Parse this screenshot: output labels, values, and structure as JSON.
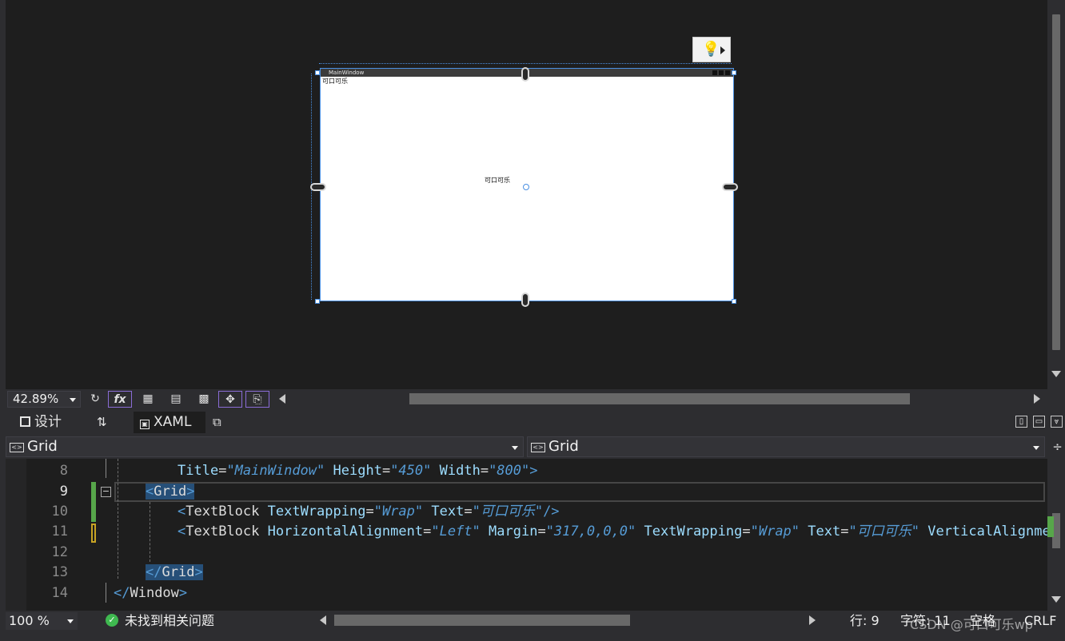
{
  "designer": {
    "window_title": "MainWindow",
    "textblock_1": "可口可乐",
    "textblock_2": "可口可乐",
    "zoom": "42.89%"
  },
  "tabs": {
    "design": "设计",
    "xaml": "XAML"
  },
  "nav": {
    "left": "Grid",
    "right": "Grid"
  },
  "code_lines": [
    {
      "num": "8"
    },
    {
      "num": "9"
    },
    {
      "num": "10"
    },
    {
      "num": "11"
    },
    {
      "num": "12"
    },
    {
      "num": "13"
    },
    {
      "num": "14"
    }
  ],
  "code": {
    "l8_attr1": "Title",
    "l8_val1": "\"MainWindow\"",
    "l8_attr2": "Height",
    "l8_val2": "\"450\"",
    "l8_attr3": "Width",
    "l8_val3": "\"800\"",
    "l9_tag": "Grid",
    "l10_tag": "TextBlock",
    "l10_attr1": "TextWrapping",
    "l10_val1": "\"Wrap\"",
    "l10_attr2": "Text",
    "l10_val2": "\"可口可乐\"",
    "l11_tag": "TextBlock",
    "l11_attr1": "HorizontalAlignment",
    "l11_val1": "\"Left\"",
    "l11_attr2": "Margin",
    "l11_val2": "\"317,0,0,0\"",
    "l11_attr3": "TextWrapping",
    "l11_val3": "\"Wrap\"",
    "l11_attr4": "Text",
    "l11_val4": "\"可口可乐\"",
    "l11_attr5": "VerticalAlignmen",
    "l13_tag": "Grid",
    "l14_tag": "Window"
  },
  "status": {
    "zoom": "100 %",
    "issues": "未找到相关问题",
    "line": "行: 9",
    "char": "字符: 11",
    "spaces": "空格",
    "eol": "CRLF",
    "watermark": "CSDN @可口可乐wp"
  },
  "colors": {
    "background": "#1e1e1e",
    "panel": "#2d2d30",
    "keyword_blue": "#569cd6",
    "attribute": "#9cdcfe",
    "selection_blue": "#4a90e2",
    "changed_green": "#57a64a",
    "changed_yellow": "#c8a424"
  }
}
